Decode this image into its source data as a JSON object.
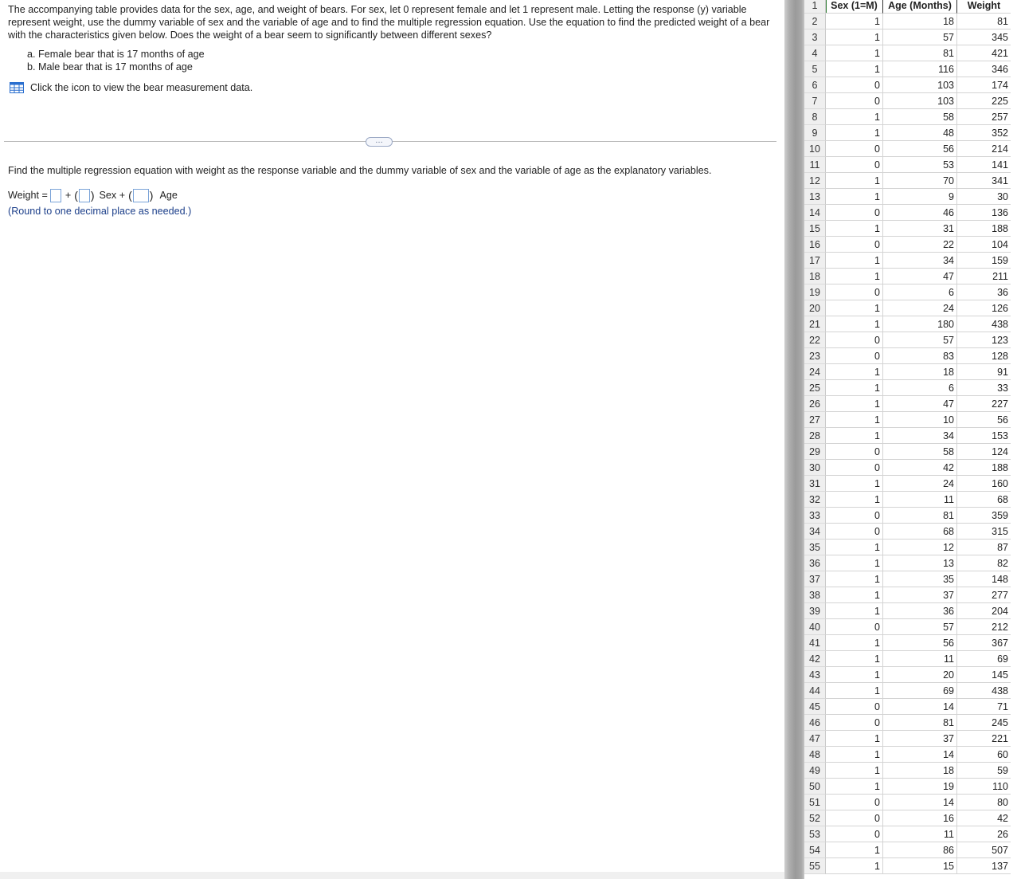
{
  "question": {
    "intro": "The accompanying table provides data for the sex, age, and weight of bears. For sex, let 0 represent female and let 1 represent male. Letting the response (y) variable represent weight, use the dummy variable of sex and the variable of age and to find the multiple regression equation. Use the equation to find the predicted weight of a bear with the characteristics given below. Does the weight of a bear seem to significantly between different sexes?",
    "part_a": "a. Female bear that is 17 months of age",
    "part_b": "b. Male bear that is 17 months of age",
    "data_link": "Click the icon to view the bear measurement data.",
    "more_label": "…",
    "find_text": "Find the multiple regression equation with weight as the response variable and the dummy variable of sex and the variable of age as the explanatory variables.",
    "eq_lhs": "Weight =",
    "eq_plus": "+",
    "eq_sex": "Sex +",
    "eq_age": "Age",
    "paren_open": "(",
    "paren_close": ")",
    "round_note": "(Round to one decimal place as needed.)"
  },
  "sheet": {
    "header": {
      "row": "1",
      "col1": "Sex (1=M)",
      "col2": "Age (Months)",
      "col3": "Weight"
    },
    "rows": [
      [
        "2",
        "1",
        "18",
        "81"
      ],
      [
        "3",
        "1",
        "57",
        "345"
      ],
      [
        "4",
        "1",
        "81",
        "421"
      ],
      [
        "5",
        "1",
        "116",
        "346"
      ],
      [
        "6",
        "0",
        "103",
        "174"
      ],
      [
        "7",
        "0",
        "103",
        "225"
      ],
      [
        "8",
        "1",
        "58",
        "257"
      ],
      [
        "9",
        "1",
        "48",
        "352"
      ],
      [
        "10",
        "0",
        "56",
        "214"
      ],
      [
        "11",
        "0",
        "53",
        "141"
      ],
      [
        "12",
        "1",
        "70",
        "341"
      ],
      [
        "13",
        "1",
        "9",
        "30"
      ],
      [
        "14",
        "0",
        "46",
        "136"
      ],
      [
        "15",
        "1",
        "31",
        "188"
      ],
      [
        "16",
        "0",
        "22",
        "104"
      ],
      [
        "17",
        "1",
        "34",
        "159"
      ],
      [
        "18",
        "1",
        "47",
        "211"
      ],
      [
        "19",
        "0",
        "6",
        "36"
      ],
      [
        "20",
        "1",
        "24",
        "126"
      ],
      [
        "21",
        "1",
        "180",
        "438"
      ],
      [
        "22",
        "0",
        "57",
        "123"
      ],
      [
        "23",
        "0",
        "83",
        "128"
      ],
      [
        "24",
        "1",
        "18",
        "91"
      ],
      [
        "25",
        "1",
        "6",
        "33"
      ],
      [
        "26",
        "1",
        "47",
        "227"
      ],
      [
        "27",
        "1",
        "10",
        "56"
      ],
      [
        "28",
        "1",
        "34",
        "153"
      ],
      [
        "29",
        "0",
        "58",
        "124"
      ],
      [
        "30",
        "0",
        "42",
        "188"
      ],
      [
        "31",
        "1",
        "24",
        "160"
      ],
      [
        "32",
        "1",
        "11",
        "68"
      ],
      [
        "33",
        "0",
        "81",
        "359"
      ],
      [
        "34",
        "0",
        "68",
        "315"
      ],
      [
        "35",
        "1",
        "12",
        "87"
      ],
      [
        "36",
        "1",
        "13",
        "82"
      ],
      [
        "37",
        "1",
        "35",
        "148"
      ],
      [
        "38",
        "1",
        "37",
        "277"
      ],
      [
        "39",
        "1",
        "36",
        "204"
      ],
      [
        "40",
        "0",
        "57",
        "212"
      ],
      [
        "41",
        "1",
        "56",
        "367"
      ],
      [
        "42",
        "1",
        "11",
        "69"
      ],
      [
        "43",
        "1",
        "20",
        "145"
      ],
      [
        "44",
        "1",
        "69",
        "438"
      ],
      [
        "45",
        "0",
        "14",
        "71"
      ],
      [
        "46",
        "0",
        "81",
        "245"
      ],
      [
        "47",
        "1",
        "37",
        "221"
      ],
      [
        "48",
        "1",
        "14",
        "60"
      ],
      [
        "49",
        "1",
        "18",
        "59"
      ],
      [
        "50",
        "1",
        "19",
        "110"
      ],
      [
        "51",
        "0",
        "14",
        "80"
      ],
      [
        "52",
        "0",
        "16",
        "42"
      ],
      [
        "53",
        "0",
        "11",
        "26"
      ],
      [
        "54",
        "1",
        "86",
        "507"
      ],
      [
        "55",
        "1",
        "15",
        "137"
      ]
    ]
  },
  "colors": {
    "accent": "#1c3f8a",
    "input_border": "#7aa3d8",
    "select_green": "#2e7d32"
  }
}
